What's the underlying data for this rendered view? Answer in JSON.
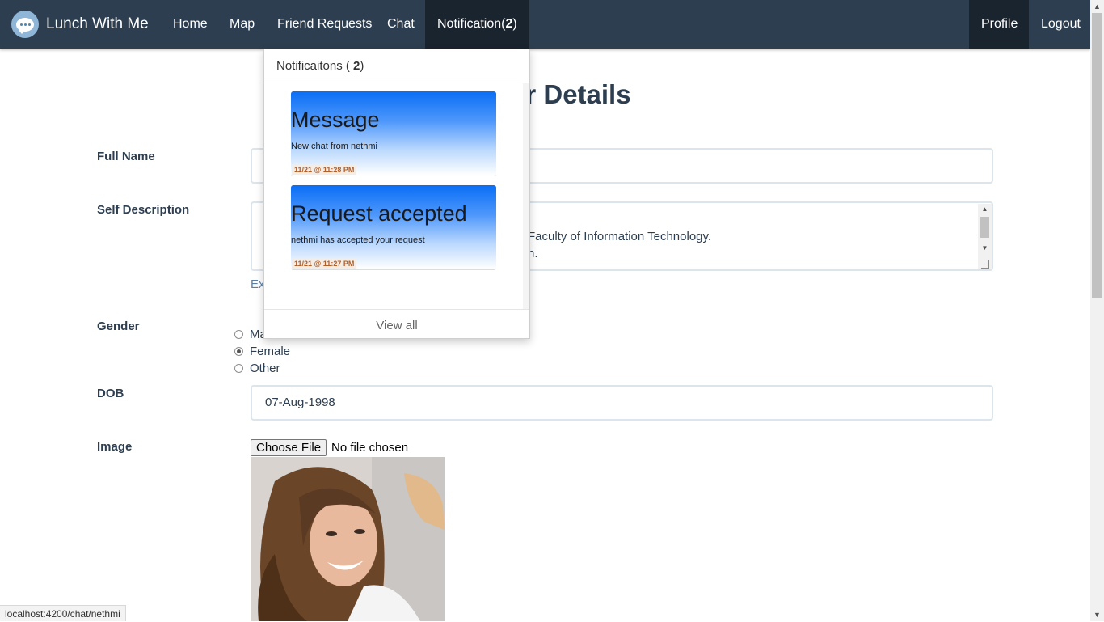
{
  "navbar": {
    "brand": "Lunch With Me",
    "items": [
      {
        "label": "Home"
      },
      {
        "label": "Map"
      },
      {
        "label": "Friend Requests"
      },
      {
        "label": "Chat"
      }
    ],
    "notification": {
      "label": "Notification(",
      "count": "2",
      "close": ")"
    },
    "profile": "Profile",
    "logout": "Logout"
  },
  "form": {
    "title": "er Details",
    "full_name_label": "Full Name",
    "self_description_label": "Self Description",
    "self_description_line1": "Faculty of Information Technology.",
    "self_description_line2": "h.",
    "link_fragment": "Ex",
    "gender_label": "Gender",
    "gender_options": [
      "Ma",
      "Female",
      "Other"
    ],
    "gender_selected": "Female",
    "dob_label": "DOB",
    "dob_value": "07-Aug-1998",
    "image_label": "Image",
    "file_button": "Choose File",
    "file_status": "No file chosen"
  },
  "notifications": {
    "header": "Notificaitons (",
    "count": "2",
    "header_close": ")",
    "items": [
      {
        "title": "Message",
        "body": "New chat from nethmi",
        "time": "11/21 @ 11:28 PM"
      },
      {
        "title": "Request accepted",
        "body": "nethmi has accepted your request",
        "time": "11/21 @ 11:27 PM"
      }
    ],
    "view_all": "View all"
  },
  "status_url": "localhost:4200/chat/nethmi",
  "colors": {
    "navbar": "#2c3e50",
    "nav_active": "#1a242f",
    "card_blue": "#0a6ef5",
    "time_text": "#b35f2a"
  }
}
